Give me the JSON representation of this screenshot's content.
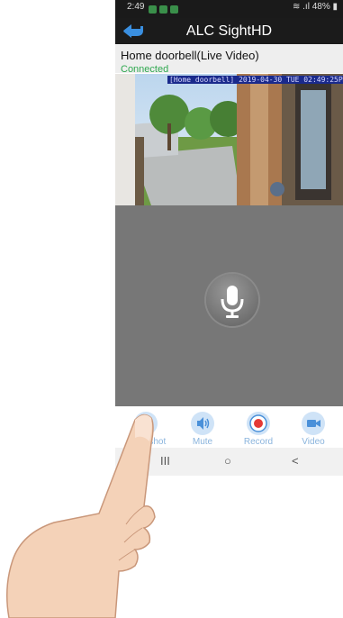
{
  "status_bar": {
    "time": "2:49",
    "battery": "48%"
  },
  "app_bar": {
    "title": "ALC SightHD"
  },
  "device": {
    "name": "Home doorbell(Live Video)",
    "status": "Connected"
  },
  "video": {
    "timestamp": "[Home doorbell] 2019-04-30 TUE 02:49:25PM"
  },
  "controls": [
    {
      "label": "Snapshot",
      "icon": "camera-icon"
    },
    {
      "label": "Mute",
      "icon": "speaker-icon"
    },
    {
      "label": "Record",
      "icon": "record-icon"
    },
    {
      "label": "Video",
      "icon": "video-camera-icon"
    }
  ],
  "nav": {
    "recents": "III",
    "home": "○",
    "back": "<"
  },
  "colors": {
    "accent": "#4a90d9",
    "record": "#e53935",
    "connected": "#2fa84f"
  }
}
